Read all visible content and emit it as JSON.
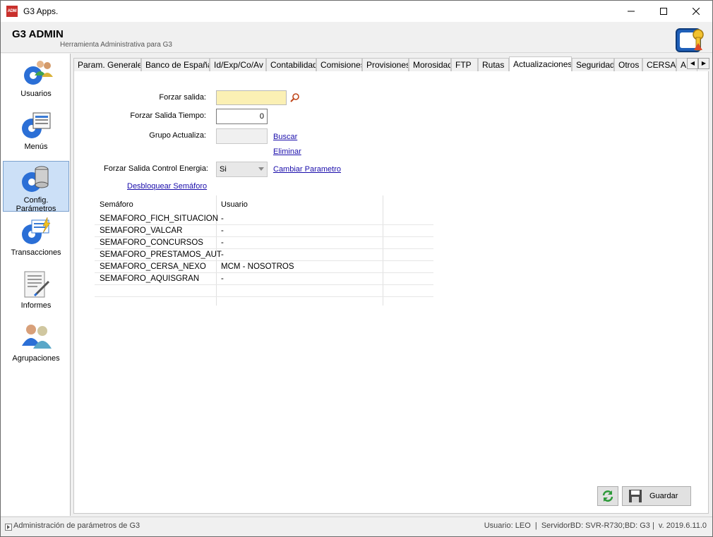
{
  "window": {
    "title": "G3 Apps.",
    "icon_text": "ADM"
  },
  "header": {
    "app_name": "G3 ADMIN",
    "subtitle": "Herramienta Administrativa para G3"
  },
  "sidebar": {
    "items": [
      {
        "label": "Usuarios",
        "icon": "users-gear-icon"
      },
      {
        "label": "Menús",
        "icon": "menu-gear-icon"
      },
      {
        "label": "Config. Parámetros",
        "icon": "database-gear-icon",
        "selected": true
      },
      {
        "label": "Transacciones",
        "icon": "transaction-gear-icon"
      },
      {
        "label": "Informes",
        "icon": "report-icon"
      },
      {
        "label": "Agrupaciones",
        "icon": "group-users-icon"
      }
    ]
  },
  "tabs": [
    "Param. Generales",
    "Banco de España",
    "Id/Exp/Co/Av",
    "Contabilidad",
    "Comisiones",
    "Provisiones",
    "Morosidad",
    "FTP",
    "Rutas",
    "Actualizaciones",
    "Seguridad",
    "Otros",
    "CERSA",
    "A"
  ],
  "active_tab": "Actualizaciones",
  "form": {
    "forzar_salida_label": "Forzar salida:",
    "forzar_salida_value": "",
    "tiempo_label": "Forzar Salida Tiempo:",
    "tiempo_value": "0",
    "grupo_label": "Grupo Actualiza:",
    "grupo_value": "",
    "buscar_link": "Buscar",
    "eliminar_link": "Eliminar",
    "energia_label": "Forzar Salida Control Energia:",
    "energia_value": "Si",
    "cambiar_link": "Cambiar Parametro",
    "desbloquear_link": "Desbloquear Semáforo"
  },
  "semaforo_table": {
    "columns": [
      "Semáforo",
      "Usuario"
    ],
    "rows": [
      [
        "SEMAFORO_FICH_SITUACION",
        "-"
      ],
      [
        "SEMAFORO_VALCAR",
        "-"
      ],
      [
        "SEMAFORO_CONCURSOS",
        "-"
      ],
      [
        "SEMAFORO_PRESTAMOS_AUT",
        "-"
      ],
      [
        "SEMAFORO_CERSA_NEXO",
        "MCM - NOSOTROS"
      ],
      [
        "SEMAFORO_AQUISGRAN",
        "-"
      ]
    ]
  },
  "buttons": {
    "guardar": "Guardar"
  },
  "status": {
    "left": "Administración de parámetros de G3",
    "right": "Usuario: LEO  |  ServidorBD: SVR-R730;BD: G3 |  v. 2019.6.11.0"
  }
}
